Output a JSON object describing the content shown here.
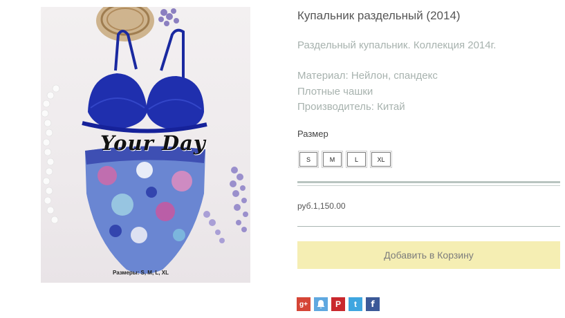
{
  "product": {
    "image_brand_text": "Your Day",
    "image_sizes_caption": "Размеры: S, M, L, XL",
    "title": "Купальник раздельный (2014)",
    "description": "Раздельный купальник. Коллекция 2014г.",
    "specs": [
      "Материал: Нейлон, спандекс",
      "Плотные чашки",
      "Производитель: Китай"
    ],
    "size_label": "Размер",
    "sizes": [
      "S",
      "M",
      "L",
      "XL"
    ],
    "price": "руб.1,150.00",
    "add_to_cart": "Добавить в Корзину"
  },
  "share": {
    "icons": [
      "google-plus-icon",
      "bell-icon",
      "pinterest-icon",
      "twitter-icon",
      "facebook-icon"
    ],
    "glyphs": [
      "g+",
      "🔔",
      "P",
      "t",
      "f"
    ]
  },
  "colors": {
    "cart_button": "#f5eeb3",
    "muted_text": "#a7b2ae",
    "swimsuit_blue": "#1f2fae"
  }
}
